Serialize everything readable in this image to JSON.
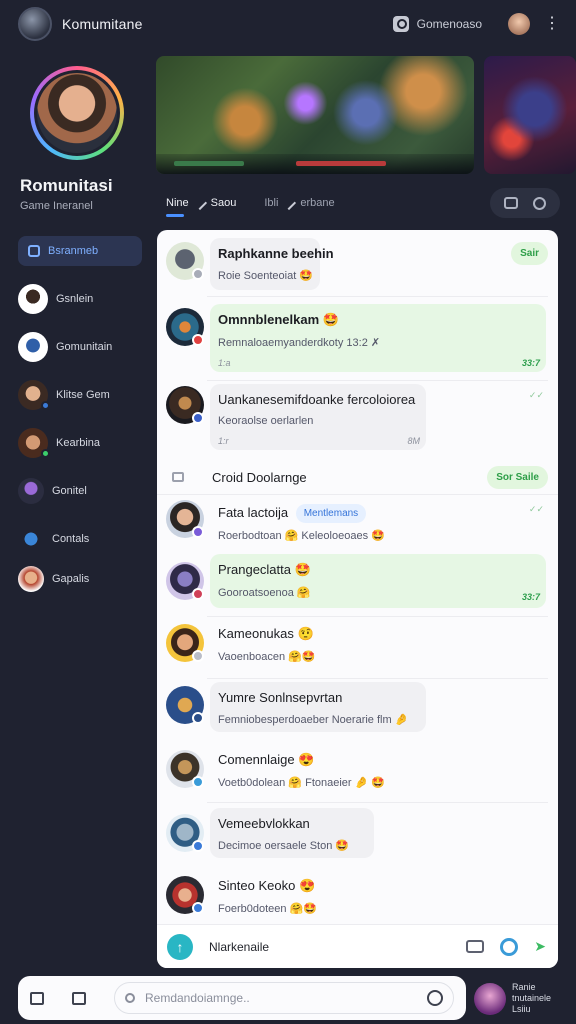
{
  "app": {
    "title": "Komumitane",
    "search_label": "Gomenoaso",
    "kebab": "⋮"
  },
  "profile": {
    "name": "Romunitasi",
    "subtitle": "Game Ineranel"
  },
  "sidebar": {
    "items": [
      {
        "label": "Bsranmeb",
        "active": true
      },
      {
        "label": "Gsnlein"
      },
      {
        "label": "Gomunitain"
      },
      {
        "label": "Klitse Gem"
      },
      {
        "label": "Kearbina"
      },
      {
        "label": "Gonitel"
      },
      {
        "label": "Contals"
      },
      {
        "label": "Gapalis"
      }
    ]
  },
  "tabs": [
    {
      "label": "Nine",
      "edit_label": "Saou",
      "active": true
    },
    {
      "label": "Ibli",
      "edit_label": "erbane",
      "active": false
    }
  ],
  "header_action": "Sair",
  "messages_top": [
    {
      "title": "Raphkanne beehin",
      "body": "Roie Soenteoiat 🤩",
      "time": "",
      "color": "grey"
    },
    {
      "title": "Omnnblenelkam 🤩",
      "body": "Remnaloaemyanderdkoty 13:2 ✗",
      "time_left": "1:a",
      "time_right": "33:7",
      "color": "green"
    },
    {
      "title": "Uankanesemifdoanke fercoloiorea",
      "body": "Keoraolse oerlarlen",
      "time_left": "1:r",
      "time_right": "8M",
      "color": "grey"
    }
  ],
  "section": {
    "title": "Croid Doolarnge",
    "action": "Sor Saile"
  },
  "messages_bottom": [
    {
      "title": "Fata lactoija",
      "tag": "Mentlemans",
      "body": "Roerbodtoan 🤗 Keleoloeoaes 🤩",
      "color": "none"
    },
    {
      "title": "Prangeclatta 🤩",
      "body": "Gooroatsoenoa 🤗",
      "time_right": "33:7",
      "color": "green"
    },
    {
      "title": "Kameonukas 🤨",
      "body": "Vaoenboacen 🤗🤩",
      "color": "none"
    },
    {
      "title": "Yumre Sonlnsepvrtan",
      "body": "Femniobesperdoaeber Noerarie flm 🤌",
      "color": "grey"
    },
    {
      "title": "Comennlaige 😍",
      "body": "Voetb0dolean 🤗 Ftonaeier 🤌 🤩",
      "color": "none"
    },
    {
      "title": "Vemeebvlokkan",
      "body": "Decimoe oersaele Ston 🤩",
      "color": "grey"
    },
    {
      "title": "Sinteo Keoko 😍",
      "body": "Foerb0doteen 🤗🤩",
      "color": "none"
    }
  ],
  "composer": {
    "plus": "↑",
    "label": "Nlarkenaile",
    "send": "➤"
  },
  "bottom": {
    "placeholder": "Remdandoiamnge..",
    "user_text": "Ranie tnutainele Lsiiu"
  },
  "colors": {
    "background": "#1f2230",
    "panel": "#fbfbfd",
    "accent_blue": "#4a90ff",
    "accent_green": "#2e9e48",
    "bubble_green": "#e6f7e4",
    "bubble_grey": "#f0f0f3"
  }
}
